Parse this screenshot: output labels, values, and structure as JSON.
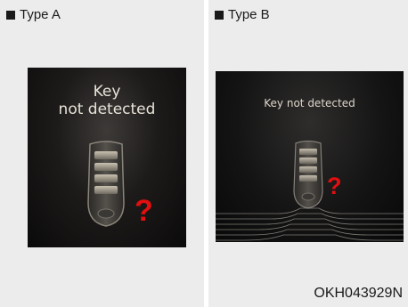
{
  "panels": [
    {
      "label": "Type A",
      "message_line1": "Key",
      "message_line2": "not detected",
      "symbol": "?"
    },
    {
      "label": "Type B",
      "message": "Key not detected",
      "symbol": "?"
    }
  ],
  "code": "OKH043929N",
  "colors": {
    "screen": "#0b0a0a",
    "text": "#e8e2d8",
    "alert": "#e10f0f"
  },
  "icons": [
    "smart-key-fob-icon",
    "question-mark-icon"
  ]
}
